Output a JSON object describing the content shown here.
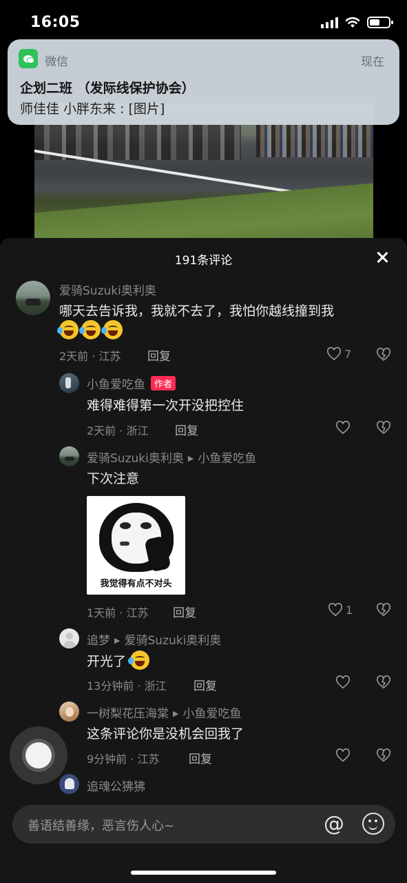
{
  "status_bar": {
    "time": "16:05"
  },
  "notification": {
    "app": "微信",
    "time": "现在",
    "title": "企划二班 （发际线保护协会）",
    "body": "师佳佳 小胖东来 : [图片]"
  },
  "sheet": {
    "title": "191条评论"
  },
  "comments": [
    {
      "user": "爱骑Suzuki奥利奥",
      "text": "哪天去告诉我，我就不去了，我怕你越线撞到我",
      "meta": "2天前 · 江苏",
      "reply_label": "回复",
      "likes": "7"
    },
    {
      "user": "小鱼爱吃鱼",
      "badge": "作者",
      "text": "难得难得第一次开没把控住",
      "meta": "2天前 · 浙江",
      "reply_label": "回复"
    },
    {
      "user": "爱骑Suzuki奥利奥",
      "reply_to": "小鱼爱吃鱼",
      "text": "下次注意",
      "sticker_caption": "我觉得有点不对头",
      "meta": "1天前 · 江苏",
      "reply_label": "回复",
      "likes": "1"
    },
    {
      "user": "追梦",
      "reply_to": "爱骑Suzuki奥利奥",
      "text": "开光了",
      "meta": "13分钟前 · 浙江",
      "reply_label": "回复"
    },
    {
      "user": "一树梨花压海棠",
      "reply_to": "小鱼爱吃鱼",
      "text": "这条评论你是没机会回我了",
      "meta": "9分钟前 · 江苏",
      "reply_label": "回复"
    },
    {
      "user": "追魂公狒狒"
    }
  ],
  "input": {
    "placeholder": "善语结善缘，恶言伤人心~"
  },
  "colors": {
    "author_badge": "#fe2c55",
    "sheet_bg": "#161616",
    "wechat_green": "#2fc15a"
  },
  "icons": [
    "wechat-icon",
    "close-icon",
    "heart-icon",
    "dislike-icon",
    "at-icon",
    "emoji-icon",
    "signal-icon",
    "wifi-icon",
    "battery-icon"
  ]
}
